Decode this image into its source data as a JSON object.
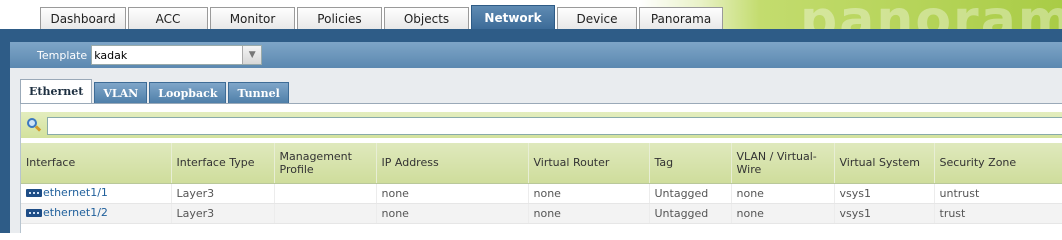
{
  "nav": {
    "tabs": [
      {
        "label": "Dashboard",
        "active": false
      },
      {
        "label": "ACC",
        "active": false
      },
      {
        "label": "Monitor",
        "active": false
      },
      {
        "label": "Policies",
        "active": false
      },
      {
        "label": "Objects",
        "active": false
      },
      {
        "label": "Network",
        "active": true
      },
      {
        "label": "Device",
        "active": false
      },
      {
        "label": "Panorama",
        "active": false
      }
    ],
    "watermark": "panorama"
  },
  "template": {
    "label": "Template",
    "value": "kadak"
  },
  "subtabs": [
    {
      "label": "Ethernet",
      "active": true
    },
    {
      "label": "VLAN",
      "active": false
    },
    {
      "label": "Loopback",
      "active": false
    },
    {
      "label": "Tunnel",
      "active": false
    }
  ],
  "search": {
    "icon": "search-icon",
    "value": ""
  },
  "table": {
    "columns": [
      "Interface",
      "Interface Type",
      "Management Profile",
      "IP Address",
      "Virtual Router",
      "Tag",
      "VLAN / Virtual-Wire",
      "Virtual System",
      "Security Zone"
    ],
    "rows": [
      {
        "interface": "ethernet1/1",
        "type": "Layer3",
        "mgmt_profile": "",
        "ip": "none",
        "vrouter": "none",
        "tag": "Untagged",
        "vlan_vwire": "none",
        "vsys": "vsys1",
        "zone": "untrust"
      },
      {
        "interface": "ethernet1/2",
        "type": "Layer3",
        "mgmt_profile": "",
        "ip": "none",
        "vrouter": "none",
        "tag": "Untagged",
        "vlan_vwire": "none",
        "vsys": "vsys1",
        "zone": "trust"
      }
    ]
  },
  "colors": {
    "nav_active": "#3b6a97",
    "band": "#2e5c87",
    "header_green": "#cfdd9c",
    "link": "#1f5f9b"
  }
}
